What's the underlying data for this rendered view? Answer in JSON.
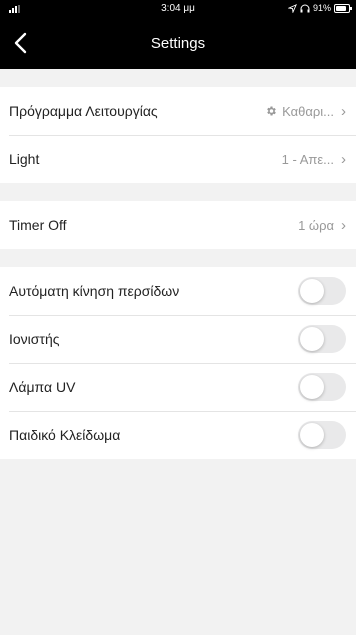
{
  "status_bar": {
    "time": "3:04 μμ",
    "battery": "91%",
    "battery_level": 0.91,
    "icons": [
      "signal-icon",
      "location-icon",
      "headphones-icon",
      "battery-icon"
    ]
  },
  "nav": {
    "title": "Settings",
    "back_icon": "chevron-left-icon"
  },
  "group1": [
    {
      "label": "Πρόγραμμα Λειτουργίας",
      "value": "Καθαρι...",
      "icon": "gear-icon"
    },
    {
      "label": "Light",
      "value": "1 - Απε..."
    }
  ],
  "group2": [
    {
      "label": "Timer Off",
      "value": "1 ώρα"
    }
  ],
  "toggles": [
    {
      "label": "Αυτόματη κίνηση περσίδων",
      "on": false
    },
    {
      "label": "Ιονιστής",
      "on": false
    },
    {
      "label": "Λάμπα UV",
      "on": false
    },
    {
      "label": "Παιδικό Κλείδωμα",
      "on": false
    }
  ],
  "colors": {
    "header_bg": "#000000",
    "page_bg": "#f2f2f2",
    "toggle_off": "#e9e9ea",
    "secondary_text": "#999999"
  }
}
